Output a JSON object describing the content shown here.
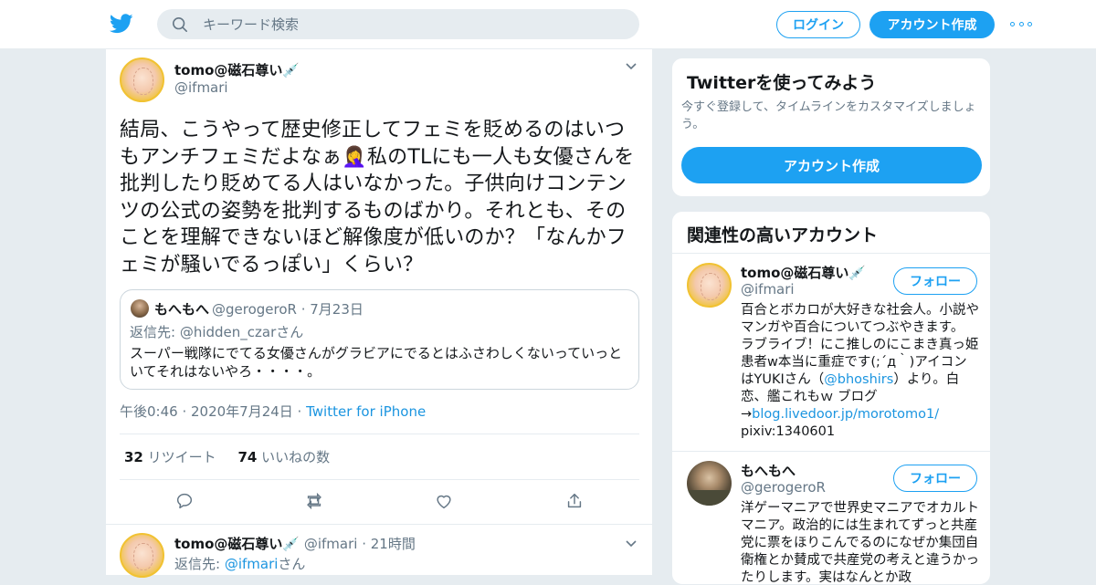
{
  "topbar": {
    "search_placeholder": "キーワード検索",
    "login": "ログイン",
    "signup": "アカウント作成"
  },
  "tweet": {
    "author": "tomo@磁石尊い💉",
    "handle": "@ifmari",
    "text": "結局、こうやって歴史修正してフェミを貶めるのはいつもアンチフェミだよなぁ🤦‍♀️私のTLにも一人も女優さんを批判したり貶めてる人はいなかった。子供向けコンテンツの公式の姿勢を批判するものばかり。それとも、そのことを理解できないほど解像度が低いのか？「なんかフェミが騒いでるっぽい」くらい？",
    "quote": {
      "name": "もへもへ",
      "handle": "@gerogeroR · 7月23日",
      "reply_prefix": "返信先: ",
      "reply_to": "@hidden_czar",
      "reply_suffix": "さん",
      "text": "スーパー戦隊にでてる女優さんがグラビアにでるとはふさわしくないっていっといてそれはないやろ・・・・。"
    },
    "time": "午後0:46 · 2020年7月24日 · ",
    "via": "Twitter for iPhone",
    "retweets": "32",
    "retweets_label": " リツイート",
    "likes": "74",
    "likes_label": " いいねの数"
  },
  "reply": {
    "author": "tomo@磁石尊い💉",
    "meta": " @ifmari · 21時間",
    "reply_prefix": "返信先: ",
    "reply_to": "@ifmari",
    "reply_suffix": "さん"
  },
  "signup_card": {
    "title": "Twitterを使ってみよう",
    "subtitle": "今すぐ登録して、タイムラインをカスタマイズしましょう。",
    "button": "アカウント作成"
  },
  "related": {
    "title": "関連性の高いアカウント",
    "follow_label": "フォロー",
    "accounts": [
      {
        "name": "tomo@磁石尊い💉",
        "handle": "@ifmari",
        "bio_1": "百合とボカロが大好きな社会人。小説やマンガや百合についてつぶやきます。 ラブライブ！にこ推しのにこまき真っ姫患者w本当に重症です(;´д｀)アイコンはYUKIさん（",
        "bio_link1": "@bhoshirs",
        "bio_2": "）より。白恋、艦これもｗ ブログ→",
        "bio_link2": "blog.livedoor.jp/morotomo1/",
        "bio_3": "pixiv:1340601"
      },
      {
        "name": "もへもへ",
        "handle": "@gerogeroR",
        "bio": "洋ゲーマニアで世界史マニアでオカルトマニア。政治的には生まれてずっと共産党に票をほりこんでるのになぜか集団自衛権とか賛成で共産党の考えと違うかったりします。実はなんとか政"
      }
    ]
  },
  "colors": {
    "accent": "#1da1f2",
    "link": "#1b95e0",
    "muted": "#657786",
    "bg": "#e6ecf0"
  }
}
